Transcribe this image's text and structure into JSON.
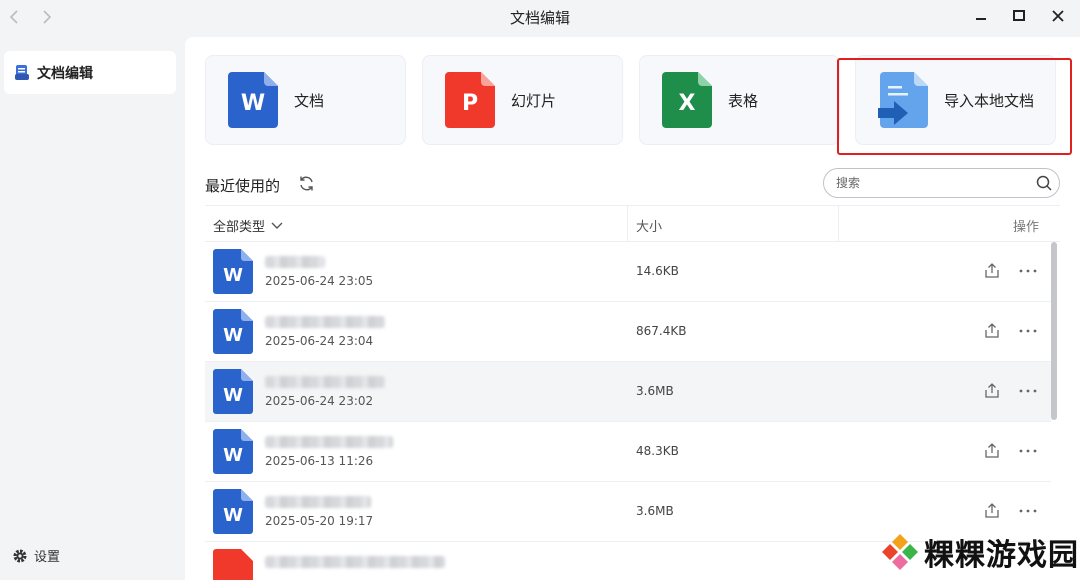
{
  "window": {
    "title": "文档编辑"
  },
  "sidebar": {
    "items": [
      {
        "label": "文档编辑"
      }
    ],
    "settings_label": "设置"
  },
  "create_cards": [
    {
      "label": "文档",
      "icon": "word-doc-icon",
      "letter": "W",
      "color": "#2b63cc"
    },
    {
      "label": "幻灯片",
      "icon": "ppt-icon",
      "letter": "P",
      "color": "#f0392b"
    },
    {
      "label": "表格",
      "icon": "excel-icon",
      "letter": "X",
      "color": "#1e8e4a"
    },
    {
      "label": "导入本地文档",
      "icon": "import-doc-icon",
      "color": "#4a90e2"
    }
  ],
  "recent": {
    "title": "最近使用的",
    "search_placeholder": "搜索"
  },
  "table": {
    "headers": {
      "type": "全部类型",
      "size": "大小",
      "actions": "操作"
    },
    "rows": [
      {
        "date": "2025-06-24 23:05",
        "size": "14.6KB",
        "icon_letter": "W"
      },
      {
        "date": "2025-06-24 23:04",
        "size": "867.4KB",
        "icon_letter": "W"
      },
      {
        "date": "2025-06-24 23:02",
        "size": "3.6MB",
        "icon_letter": "W"
      },
      {
        "date": "2025-06-13 11:26",
        "size": "48.3KB",
        "icon_letter": "W"
      },
      {
        "date": "2025-05-20 19:17",
        "size": "3.6MB",
        "icon_letter": "W"
      }
    ]
  },
  "watermark": {
    "text": "粿粿游戏园"
  }
}
